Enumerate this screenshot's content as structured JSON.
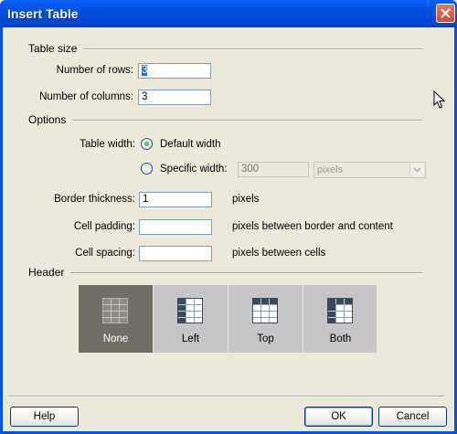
{
  "window": {
    "title": "Insert Table"
  },
  "table_size": {
    "section_label": "Table size",
    "rows_label": "Number of rows:",
    "rows_value": "3",
    "columns_label": "Number of columns:",
    "columns_value": "3"
  },
  "options": {
    "section_label": "Options",
    "table_width_label": "Table width:",
    "default_width_label": "Default width",
    "specific_width_label": "Specific width:",
    "specific_width_value": "300",
    "width_unit": "pixels",
    "selected_width_option": "default",
    "border_label": "Border thickness:",
    "border_value": "1",
    "border_unit": "pixels",
    "padding_label": "Cell padding:",
    "padding_value": "",
    "padding_unit": "pixels between border and content",
    "spacing_label": "Cell spacing:",
    "spacing_value": "",
    "spacing_unit": "pixels between cells"
  },
  "header": {
    "section_label": "Header",
    "selected": "None",
    "buttons": [
      {
        "label": "None",
        "icon": "table-header-none-icon"
      },
      {
        "label": "Left",
        "icon": "table-header-left-icon"
      },
      {
        "label": "Top",
        "icon": "table-header-top-icon"
      },
      {
        "label": "Both",
        "icon": "table-header-both-icon"
      }
    ]
  },
  "footer": {
    "help": "Help",
    "ok": "OK",
    "cancel": "Cancel"
  },
  "colors": {
    "title_bar": "#0054e3",
    "dialog_bg": "#ece9d8",
    "selected_header": "#716f64"
  }
}
